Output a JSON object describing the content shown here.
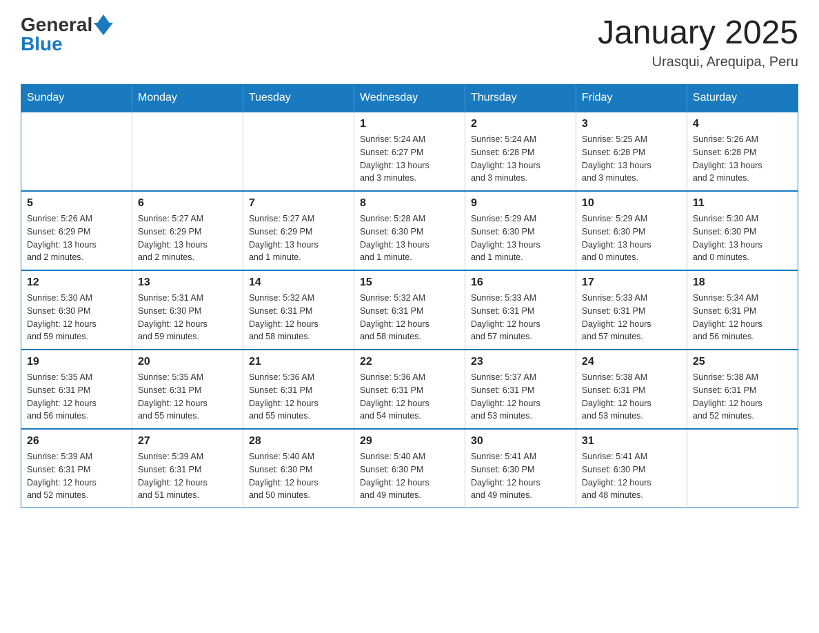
{
  "header": {
    "logo_general": "General",
    "logo_blue": "Blue",
    "month_title": "January 2025",
    "location": "Urasqui, Arequipa, Peru"
  },
  "weekdays": [
    "Sunday",
    "Monday",
    "Tuesday",
    "Wednesday",
    "Thursday",
    "Friday",
    "Saturday"
  ],
  "weeks": [
    [
      {
        "day": "",
        "info": ""
      },
      {
        "day": "",
        "info": ""
      },
      {
        "day": "",
        "info": ""
      },
      {
        "day": "1",
        "info": "Sunrise: 5:24 AM\nSunset: 6:27 PM\nDaylight: 13 hours\nand 3 minutes."
      },
      {
        "day": "2",
        "info": "Sunrise: 5:24 AM\nSunset: 6:28 PM\nDaylight: 13 hours\nand 3 minutes."
      },
      {
        "day": "3",
        "info": "Sunrise: 5:25 AM\nSunset: 6:28 PM\nDaylight: 13 hours\nand 3 minutes."
      },
      {
        "day": "4",
        "info": "Sunrise: 5:26 AM\nSunset: 6:28 PM\nDaylight: 13 hours\nand 2 minutes."
      }
    ],
    [
      {
        "day": "5",
        "info": "Sunrise: 5:26 AM\nSunset: 6:29 PM\nDaylight: 13 hours\nand 2 minutes."
      },
      {
        "day": "6",
        "info": "Sunrise: 5:27 AM\nSunset: 6:29 PM\nDaylight: 13 hours\nand 2 minutes."
      },
      {
        "day": "7",
        "info": "Sunrise: 5:27 AM\nSunset: 6:29 PM\nDaylight: 13 hours\nand 1 minute."
      },
      {
        "day": "8",
        "info": "Sunrise: 5:28 AM\nSunset: 6:30 PM\nDaylight: 13 hours\nand 1 minute."
      },
      {
        "day": "9",
        "info": "Sunrise: 5:29 AM\nSunset: 6:30 PM\nDaylight: 13 hours\nand 1 minute."
      },
      {
        "day": "10",
        "info": "Sunrise: 5:29 AM\nSunset: 6:30 PM\nDaylight: 13 hours\nand 0 minutes."
      },
      {
        "day": "11",
        "info": "Sunrise: 5:30 AM\nSunset: 6:30 PM\nDaylight: 13 hours\nand 0 minutes."
      }
    ],
    [
      {
        "day": "12",
        "info": "Sunrise: 5:30 AM\nSunset: 6:30 PM\nDaylight: 12 hours\nand 59 minutes."
      },
      {
        "day": "13",
        "info": "Sunrise: 5:31 AM\nSunset: 6:30 PM\nDaylight: 12 hours\nand 59 minutes."
      },
      {
        "day": "14",
        "info": "Sunrise: 5:32 AM\nSunset: 6:31 PM\nDaylight: 12 hours\nand 58 minutes."
      },
      {
        "day": "15",
        "info": "Sunrise: 5:32 AM\nSunset: 6:31 PM\nDaylight: 12 hours\nand 58 minutes."
      },
      {
        "day": "16",
        "info": "Sunrise: 5:33 AM\nSunset: 6:31 PM\nDaylight: 12 hours\nand 57 minutes."
      },
      {
        "day": "17",
        "info": "Sunrise: 5:33 AM\nSunset: 6:31 PM\nDaylight: 12 hours\nand 57 minutes."
      },
      {
        "day": "18",
        "info": "Sunrise: 5:34 AM\nSunset: 6:31 PM\nDaylight: 12 hours\nand 56 minutes."
      }
    ],
    [
      {
        "day": "19",
        "info": "Sunrise: 5:35 AM\nSunset: 6:31 PM\nDaylight: 12 hours\nand 56 minutes."
      },
      {
        "day": "20",
        "info": "Sunrise: 5:35 AM\nSunset: 6:31 PM\nDaylight: 12 hours\nand 55 minutes."
      },
      {
        "day": "21",
        "info": "Sunrise: 5:36 AM\nSunset: 6:31 PM\nDaylight: 12 hours\nand 55 minutes."
      },
      {
        "day": "22",
        "info": "Sunrise: 5:36 AM\nSunset: 6:31 PM\nDaylight: 12 hours\nand 54 minutes."
      },
      {
        "day": "23",
        "info": "Sunrise: 5:37 AM\nSunset: 6:31 PM\nDaylight: 12 hours\nand 53 minutes."
      },
      {
        "day": "24",
        "info": "Sunrise: 5:38 AM\nSunset: 6:31 PM\nDaylight: 12 hours\nand 53 minutes."
      },
      {
        "day": "25",
        "info": "Sunrise: 5:38 AM\nSunset: 6:31 PM\nDaylight: 12 hours\nand 52 minutes."
      }
    ],
    [
      {
        "day": "26",
        "info": "Sunrise: 5:39 AM\nSunset: 6:31 PM\nDaylight: 12 hours\nand 52 minutes."
      },
      {
        "day": "27",
        "info": "Sunrise: 5:39 AM\nSunset: 6:31 PM\nDaylight: 12 hours\nand 51 minutes."
      },
      {
        "day": "28",
        "info": "Sunrise: 5:40 AM\nSunset: 6:30 PM\nDaylight: 12 hours\nand 50 minutes."
      },
      {
        "day": "29",
        "info": "Sunrise: 5:40 AM\nSunset: 6:30 PM\nDaylight: 12 hours\nand 49 minutes."
      },
      {
        "day": "30",
        "info": "Sunrise: 5:41 AM\nSunset: 6:30 PM\nDaylight: 12 hours\nand 49 minutes."
      },
      {
        "day": "31",
        "info": "Sunrise: 5:41 AM\nSunset: 6:30 PM\nDaylight: 12 hours\nand 48 minutes."
      },
      {
        "day": "",
        "info": ""
      }
    ]
  ]
}
